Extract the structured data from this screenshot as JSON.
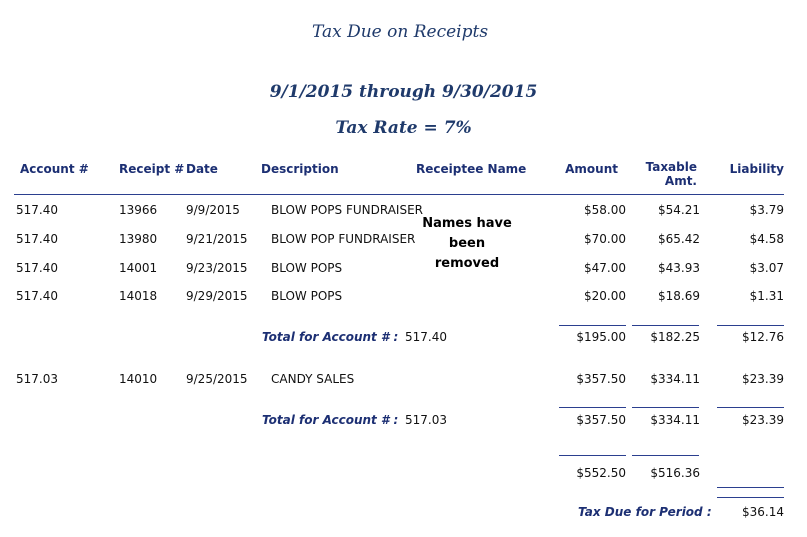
{
  "report": {
    "title": "Tax Due on Receipts",
    "date_range": "9/1/2015  through  9/30/2015",
    "tax_rate": "Tax Rate =  7%"
  },
  "columns": {
    "account": "Account #",
    "receipt": "Receipt #",
    "date": "Date",
    "description": "Description",
    "receiptee": "Receiptee Name",
    "amount": "Amount",
    "taxable_1": "Taxable",
    "taxable_2": "Amt.",
    "liability": "Liability"
  },
  "note": {
    "line1": "Names have",
    "line2": "been",
    "line3": "removed"
  },
  "groups": [
    {
      "rows": [
        {
          "account": "517.40",
          "receipt": "13966",
          "date": "9/9/2015",
          "description": "BLOW POPS FUNDRAISER",
          "amount": "$58.00",
          "taxable": "$54.21",
          "liability": "$3.79"
        },
        {
          "account": "517.40",
          "receipt": "13980",
          "date": "9/21/2015",
          "description": "BLOW POP FUNDRAISER",
          "amount": "$70.00",
          "taxable": "$65.42",
          "liability": "$4.58"
        },
        {
          "account": "517.40",
          "receipt": "14001",
          "date": "9/23/2015",
          "description": "BLOW POPS",
          "amount": "$47.00",
          "taxable": "$43.93",
          "liability": "$3.07"
        },
        {
          "account": "517.40",
          "receipt": "14018",
          "date": "9/29/2015",
          "description": "BLOW POPS",
          "amount": "$20.00",
          "taxable": "$18.69",
          "liability": "$1.31"
        }
      ],
      "total": {
        "label": "Total for Account # :",
        "account": "517.40",
        "amount": "$195.00",
        "taxable": "$182.25",
        "liability": "$12.76"
      }
    },
    {
      "rows": [
        {
          "account": "517.03",
          "receipt": "14010",
          "date": "9/25/2015",
          "description": "CANDY SALES",
          "amount": "$357.50",
          "taxable": "$334.11",
          "liability": "$23.39"
        }
      ],
      "total": {
        "label": "Total for Account # :",
        "account": "517.03",
        "amount": "$357.50",
        "taxable": "$334.11",
        "liability": "$23.39"
      }
    }
  ],
  "grand_total": {
    "amount": "$552.50",
    "taxable": "$516.36"
  },
  "tax_due": {
    "label": "Tax Due for Period :",
    "value": "$36.14"
  }
}
